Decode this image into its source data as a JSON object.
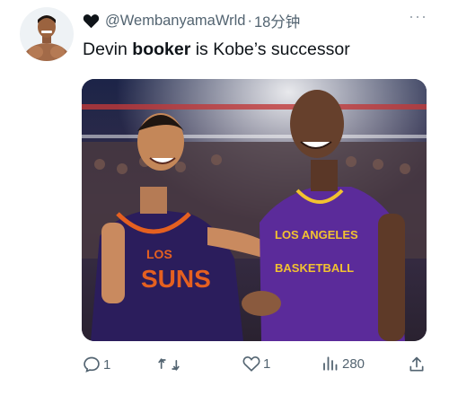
{
  "tweet": {
    "author_handle": "@WembanyamaWrld",
    "separator": "·",
    "time": "18分钟",
    "text_pre": "Devin ",
    "text_bold": "booker",
    "text_post": " is Kobe’s successor",
    "more_label": "···"
  },
  "media": {
    "jersey_left_line1": "LOS",
    "jersey_left_line2": "SUNS",
    "jersey_right_line1": "LOS ANGELES",
    "jersey_right_line2": "BASKETBALL"
  },
  "actions": {
    "reply_count": "1",
    "retweet_count": "",
    "like_count": "1",
    "view_count": "280"
  },
  "colors": {
    "text": "#0f1419",
    "muted": "#536471",
    "suns_purple": "#2b1d5c",
    "suns_orange": "#e56020",
    "lakers_purple": "#5b2b9a",
    "lakers_gold": "#f2c230"
  }
}
